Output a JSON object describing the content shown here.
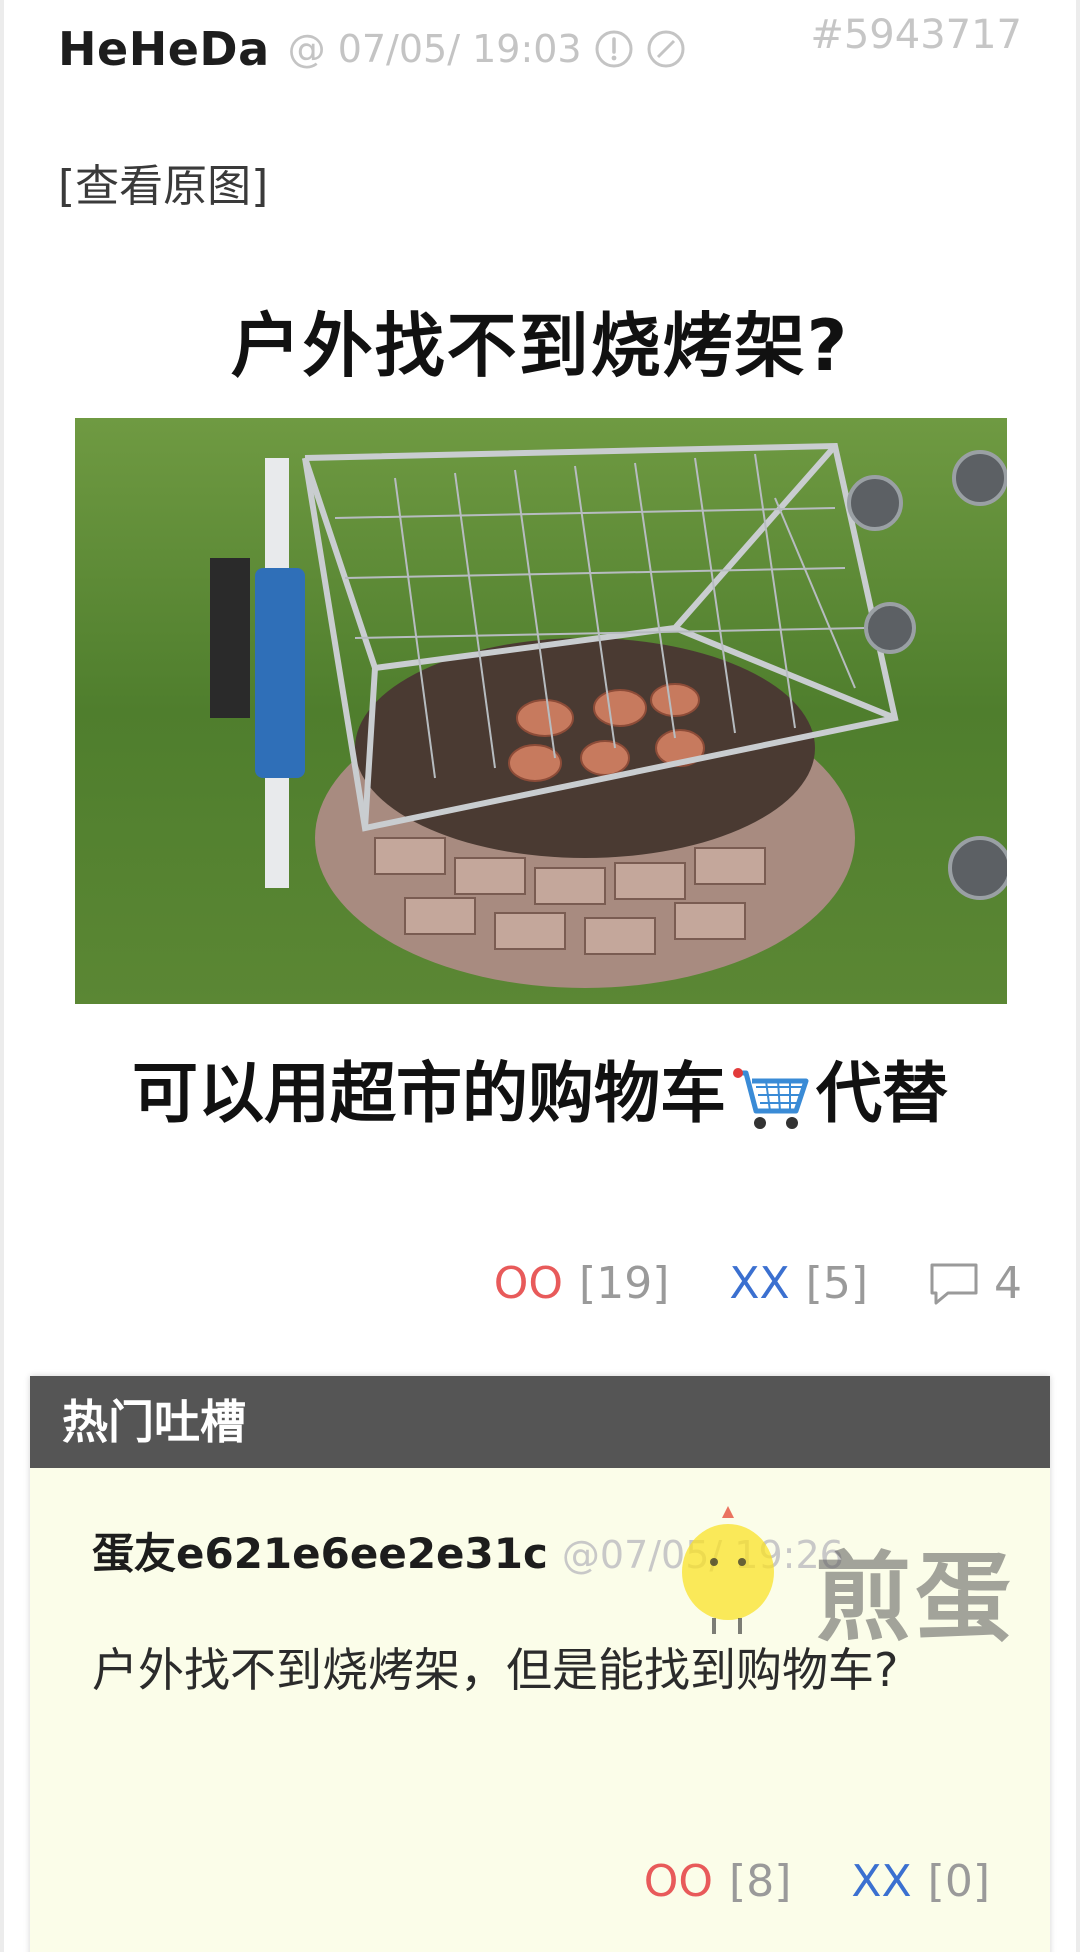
{
  "post": {
    "author": "HeHeDa",
    "time": "@ 07/05/ 19:03",
    "id": "#5943717",
    "icons": [
      "report-icon",
      "block-icon"
    ],
    "view_original": "[查看原图]"
  },
  "meme": {
    "top_text": "户外找不到烧烤架?",
    "bottom_text": "可以用超市的购物车",
    "bottom_text_suffix": "代替"
  },
  "votes": {
    "oo_label": "OO",
    "oo_count": "[19]",
    "xx_label": "XX",
    "xx_count": "[5]",
    "comments_count": "4"
  },
  "hot_comments": {
    "title": "热门吐槽",
    "items": [
      {
        "author": "蛋友e621e6ee2e31c",
        "time": "@07/05/ 19:26",
        "body": "户外找不到烧烤架，但是能找到购物车?",
        "oo_label": "OO",
        "oo_count": "[8]",
        "xx_label": "XX",
        "xx_count": "[0]"
      }
    ]
  },
  "watermark": {
    "text": "煎蛋"
  },
  "colors": {
    "oo": "#e85a5a",
    "xx": "#3b70d0",
    "hot_header_bg": "#555555",
    "hot_body_bg": "#fbfde9"
  }
}
